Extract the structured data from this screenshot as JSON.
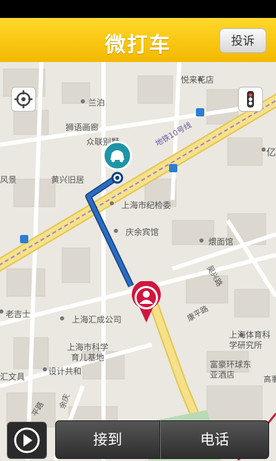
{
  "header": {
    "title": "微打车",
    "complain_label": "投诉"
  },
  "map": {
    "labels": {
      "yuelai": "悦来花店",
      "lanbo": "兰泊",
      "shiyu": "狮语画廊",
      "zhonglian": "众联别墅",
      "metro": "地铁10号线",
      "yi": "亿",
      "fengjing": "风景",
      "huangxing": "黄兴旧居",
      "jijiwei": "上海市纪检委",
      "qingyu": "庆余宾馆",
      "weimian": "煨面馆",
      "jiangxing": "吴兴路",
      "kangping": "康平路",
      "laojishi": "老吉士",
      "huicheng": "上海汇成公司",
      "kexue": "上海市科学育儿基地",
      "tiyu": "上海体育科学研究所",
      "shejihe": "设计共和",
      "huiwen": "汇文具",
      "fuhao": "富豪环球东亚酒店",
      "pinglu": "平路",
      "yuqing": "余庆",
      "gaoshi": "高事"
    },
    "colors": {
      "route": "#1f5aa6",
      "road_major": "#f6e08a",
      "driver_pin": "#1e94a7",
      "passenger_pin": "#d0163e"
    }
  },
  "bottom": {
    "pickup_label": "接到",
    "call_label": "电话"
  }
}
